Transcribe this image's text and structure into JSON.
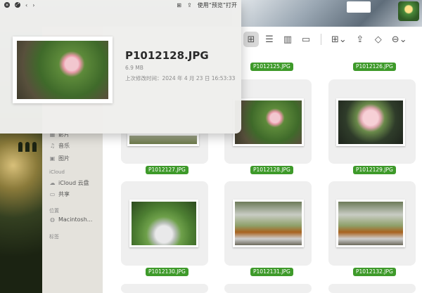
{
  "quicklook": {
    "open_with_label": "使用“预览”打开",
    "filename": "P1012128.JPG",
    "size": "6.9 MB",
    "modified": "上次修改时间：2024 年 4 月 23 日 16:53:33"
  },
  "sidebar": {
    "items_top": [
      {
        "label": "影片",
        "icon": "film-icon"
      },
      {
        "label": "音乐",
        "icon": "music-icon"
      },
      {
        "label": "图片",
        "icon": "photo-icon"
      }
    ],
    "icloud_header": "iCloud",
    "icloud_items": [
      {
        "label": "iCloud 云盘",
        "icon": "cloud-icon"
      },
      {
        "label": "共享",
        "icon": "shared-icon"
      }
    ],
    "locations_header": "位置",
    "locations_items": [
      {
        "label": "Macintosh...",
        "icon": "disk-icon"
      }
    ],
    "tags_header": "标签"
  },
  "files": [
    {
      "name": "P1012125.JPG"
    },
    {
      "name": "P1012126.JPG"
    },
    {
      "name": "P1012127.JPG"
    },
    {
      "name": "P1012128.JPG"
    },
    {
      "name": "P1012129.JPG"
    },
    {
      "name": "P1012130.JPG"
    },
    {
      "name": "P1012131.JPG"
    },
    {
      "name": "P1012132.JPG"
    }
  ],
  "colors": {
    "label_green": "#3e9a2a",
    "sidebar_bg": "#e4e2dc"
  }
}
